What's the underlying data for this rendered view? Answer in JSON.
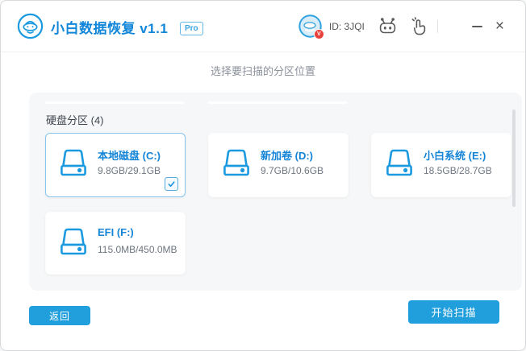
{
  "titlebar": {
    "app_title": "小白数据恢复 v1.1",
    "pro_badge": "Pro",
    "user_id": "ID: 3JQI",
    "vip_badge": "V",
    "close_glyph": "×"
  },
  "main": {
    "heading": "选择要扫描的分区位置",
    "section_label": "硬盘分区 (4)",
    "partitions": [
      {
        "name": "本地磁盘 (C:)",
        "size": "9.8GB/29.1GB",
        "selected": true
      },
      {
        "name": "新加卷 (D:)",
        "size": "9.7GB/10.6GB",
        "selected": false
      },
      {
        "name": "小白系统 (E:)",
        "size": "18.5GB/28.7GB",
        "selected": false
      },
      {
        "name": "EFI (F:)",
        "size": "115.0MB/450.0MB",
        "selected": false
      }
    ]
  },
  "footer": {
    "back_label": "返回",
    "start_scan_label": "开始扫描"
  },
  "colors": {
    "accent_blue": "#1b9ae0",
    "title_blue": "#1286d9",
    "name_blue": "#1484d7",
    "button_blue": "#219edc",
    "panel_bg": "#f6f7f8",
    "vip_red": "#e8413c",
    "selected_border": "#85c5ec"
  }
}
